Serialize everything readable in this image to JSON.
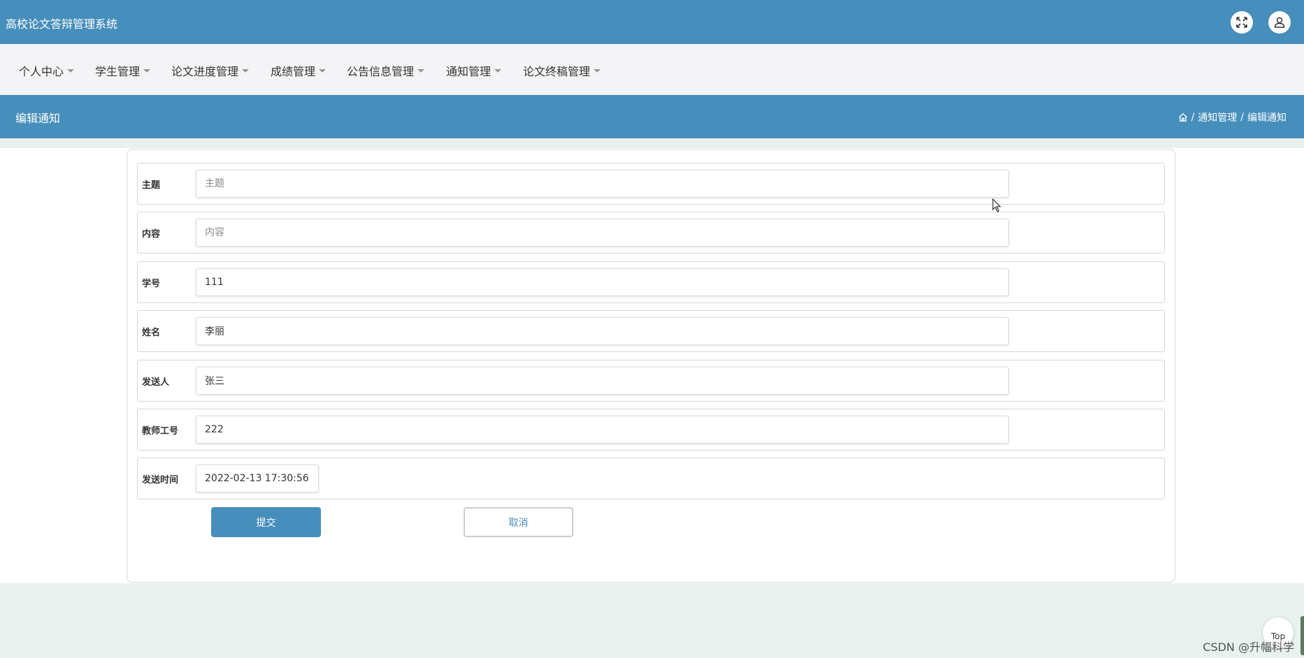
{
  "app": {
    "title": "高校论文答辩管理系统"
  },
  "nav": {
    "items": [
      {
        "label": "个人中心"
      },
      {
        "label": "学生管理"
      },
      {
        "label": "论文进度管理"
      },
      {
        "label": "成绩管理"
      },
      {
        "label": "公告信息管理"
      },
      {
        "label": "通知管理"
      },
      {
        "label": "论文终稿管理"
      }
    ]
  },
  "page": {
    "title": "编辑通知",
    "breadcrumb": [
      "通知管理",
      "编辑通知"
    ]
  },
  "form": {
    "fields": [
      {
        "label": "主题",
        "value": "",
        "placeholder": "主题"
      },
      {
        "label": "内容",
        "value": "",
        "placeholder": "内容"
      },
      {
        "label": "学号",
        "value": "111",
        "placeholder": ""
      },
      {
        "label": "姓名",
        "value": "李丽",
        "placeholder": ""
      },
      {
        "label": "发送人",
        "value": "张三",
        "placeholder": ""
      },
      {
        "label": "教师工号",
        "value": "222",
        "placeholder": ""
      },
      {
        "label": "发送时间",
        "value": "2022-02-13 17:30:56",
        "placeholder": ""
      }
    ],
    "submit_label": "提交",
    "cancel_label": "取消"
  },
  "footer": {
    "top_label": "Top",
    "watermark": "CSDN @升幅科学"
  },
  "colors": {
    "primary": "#468ebb",
    "nav_bg": "#f4f4f6",
    "page_bg": "#e8f1ee"
  },
  "icons": {
    "fullscreen": "fullscreen-icon",
    "user": "user-icon",
    "home": "home-icon",
    "caret": "caret-down-icon"
  }
}
